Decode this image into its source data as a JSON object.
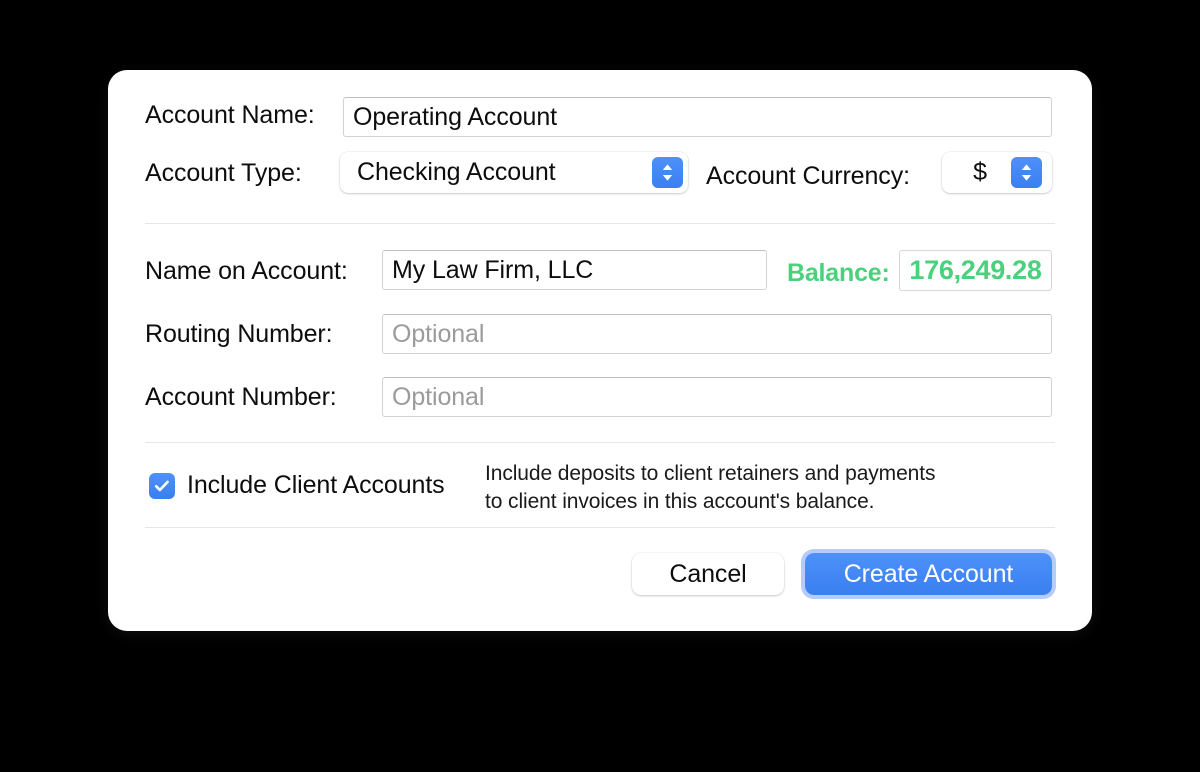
{
  "dialog": {
    "title": "",
    "fields": {
      "account_name": {
        "label": "Account Name:",
        "value": "Operating Account",
        "placeholder": ""
      },
      "account_type": {
        "label": "Account Type:",
        "value": "Checking Account",
        "options": [
          "Checking Account"
        ]
      },
      "account_currency": {
        "label": "Account Currency:",
        "value": "$",
        "options": [
          "$"
        ]
      },
      "name_on_account": {
        "label": "Name on Account:",
        "value": "My Law Firm, LLC",
        "placeholder": ""
      },
      "routing_number": {
        "label": "Routing Number:",
        "value": "",
        "placeholder": "Optional"
      },
      "account_number": {
        "label": "Account Number:",
        "value": "",
        "placeholder": "Optional"
      }
    },
    "balance": {
      "label": "Balance:",
      "value": "176,249.28",
      "color": "#4bd07c"
    },
    "include_client_accounts": {
      "label": "Include Client Accounts",
      "checked": true,
      "help": "Include deposits to client retainers and payments\nto client invoices in this account's balance."
    },
    "buttons": {
      "cancel": "Cancel",
      "create": "Create Account"
    },
    "accent_color": "#3a7ff0"
  }
}
